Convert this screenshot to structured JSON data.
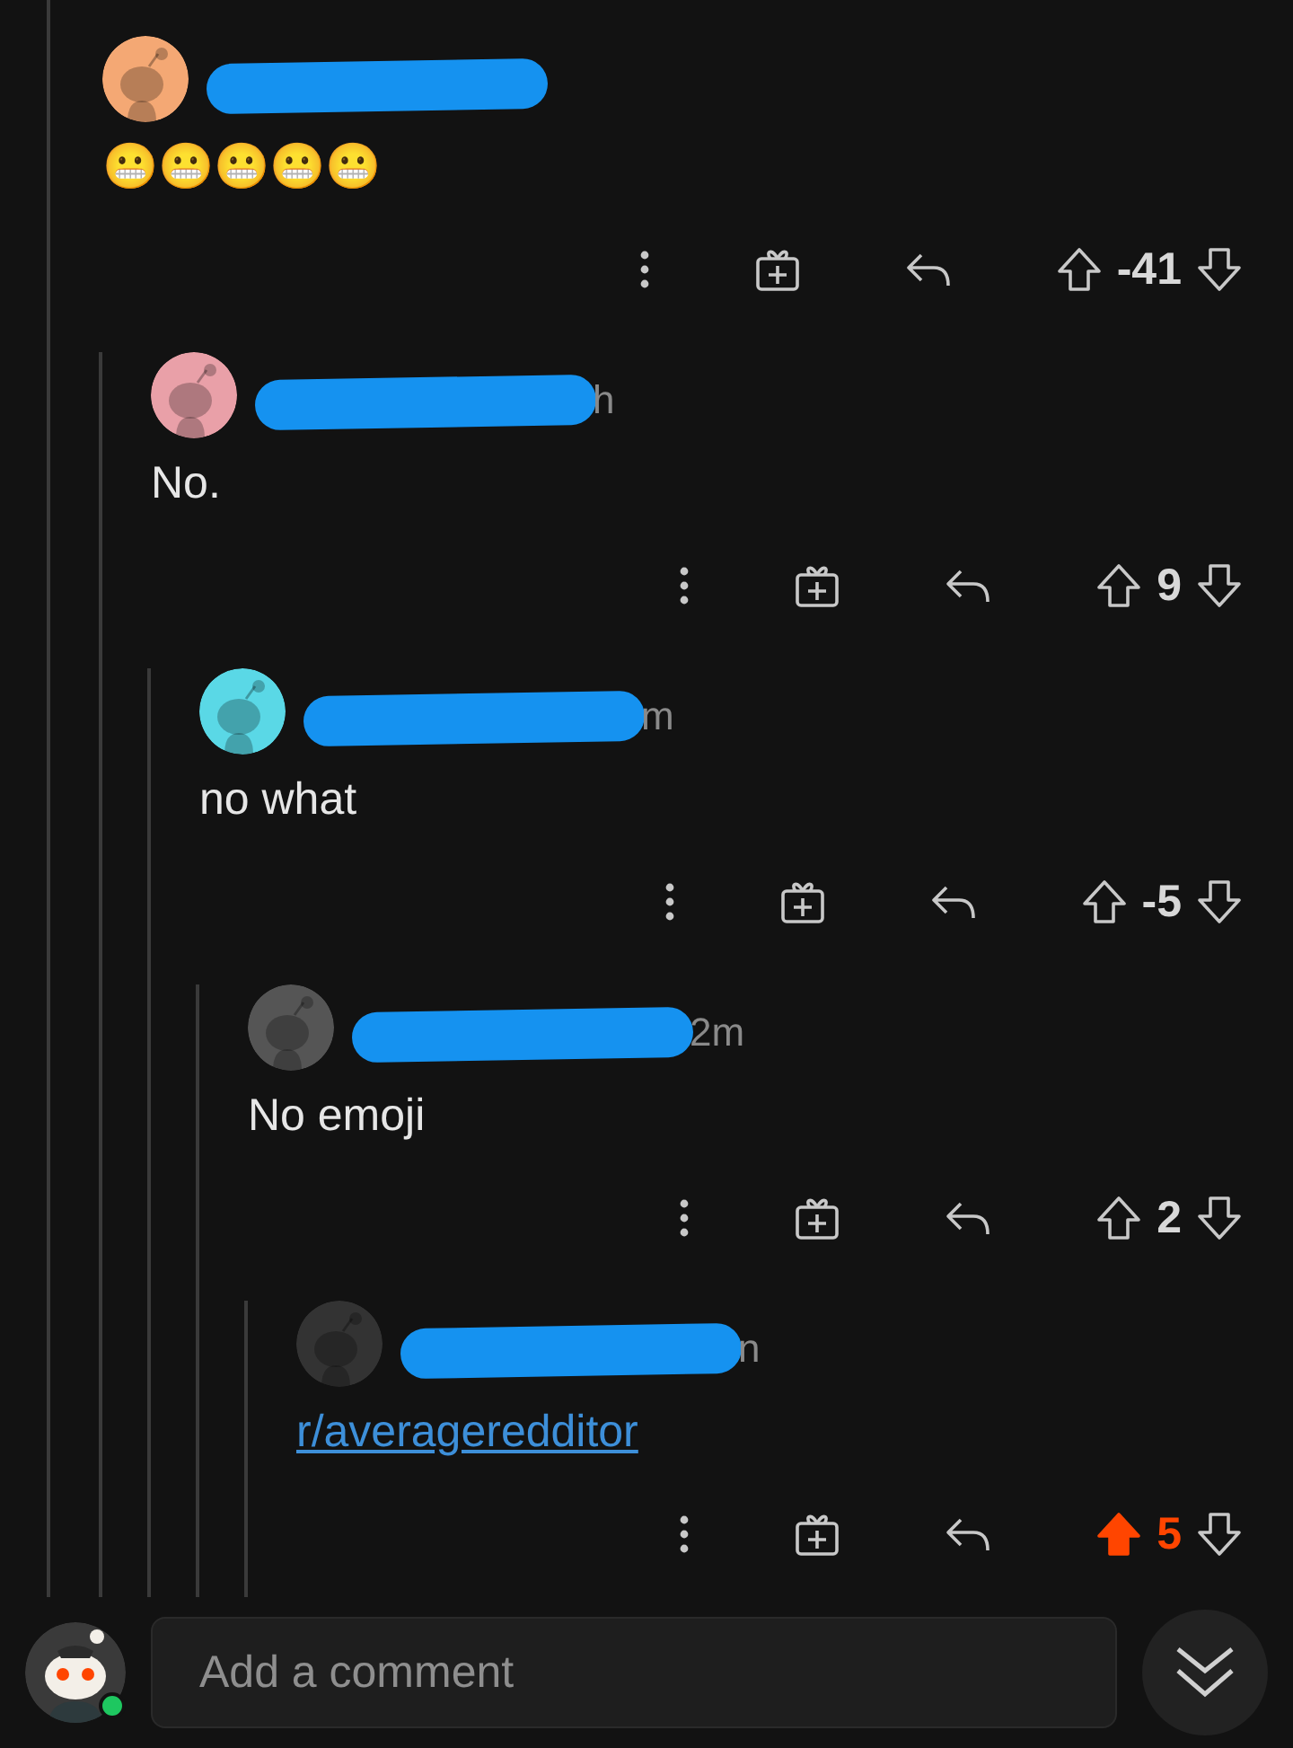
{
  "comments": [
    {
      "color": "#f4a874",
      "redacted": true,
      "body": {
        "kind": "text",
        "text": "😬😬😬😬😬"
      },
      "score": "-41",
      "upvoted": false,
      "children": [
        {
          "color": "#e9a0a8",
          "redacted": true,
          "meta": "h",
          "body": {
            "kind": "text",
            "text": "No."
          },
          "score": "9",
          "upvoted": false,
          "children": [
            {
              "color": "#5ad8e6",
              "redacted": true,
              "meta": "m",
              "body": {
                "kind": "text",
                "text": "no what"
              },
              "score": "-5",
              "upvoted": false,
              "children": [
                {
                  "color": "#555555",
                  "redacted": true,
                  "meta": "2m",
                  "body": {
                    "kind": "text",
                    "text": "No emoji"
                  },
                  "score": "2",
                  "upvoted": false,
                  "children": [
                    {
                      "color": "#333333",
                      "redacted": true,
                      "meta": "n",
                      "body": {
                        "kind": "link",
                        "text": "r/averageredditor"
                      },
                      "score": "5",
                      "upvoted": true
                    }
                  ]
                }
              ]
            }
          ]
        }
      ]
    }
  ],
  "composer": {
    "placeholder": "Add a comment",
    "online": true
  }
}
